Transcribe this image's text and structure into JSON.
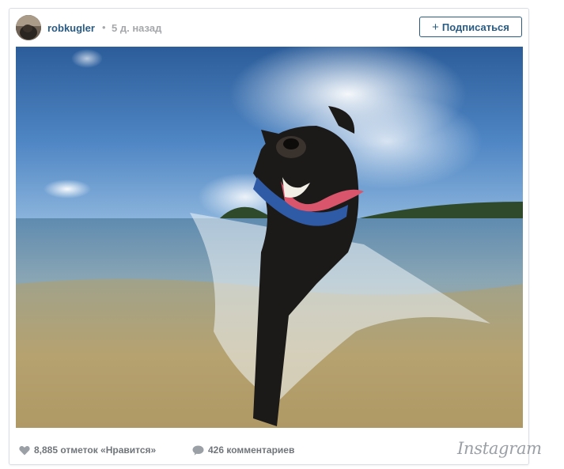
{
  "header": {
    "username": "robkugler",
    "separator": "•",
    "timestamp": "5 д. назад",
    "follow_label": "Подписаться",
    "follow_plus": "+"
  },
  "footer": {
    "likes_text": "8,885 отметок «Нравится»",
    "comments_text": "426 комментариев",
    "logo_text": "Instagram"
  },
  "colors": {
    "accent": "#2a5b83",
    "muted": "#a5a7aa",
    "footer_text": "#70757a"
  },
  "icons": {
    "like": "heart-icon",
    "comment": "speech-bubble-icon"
  }
}
